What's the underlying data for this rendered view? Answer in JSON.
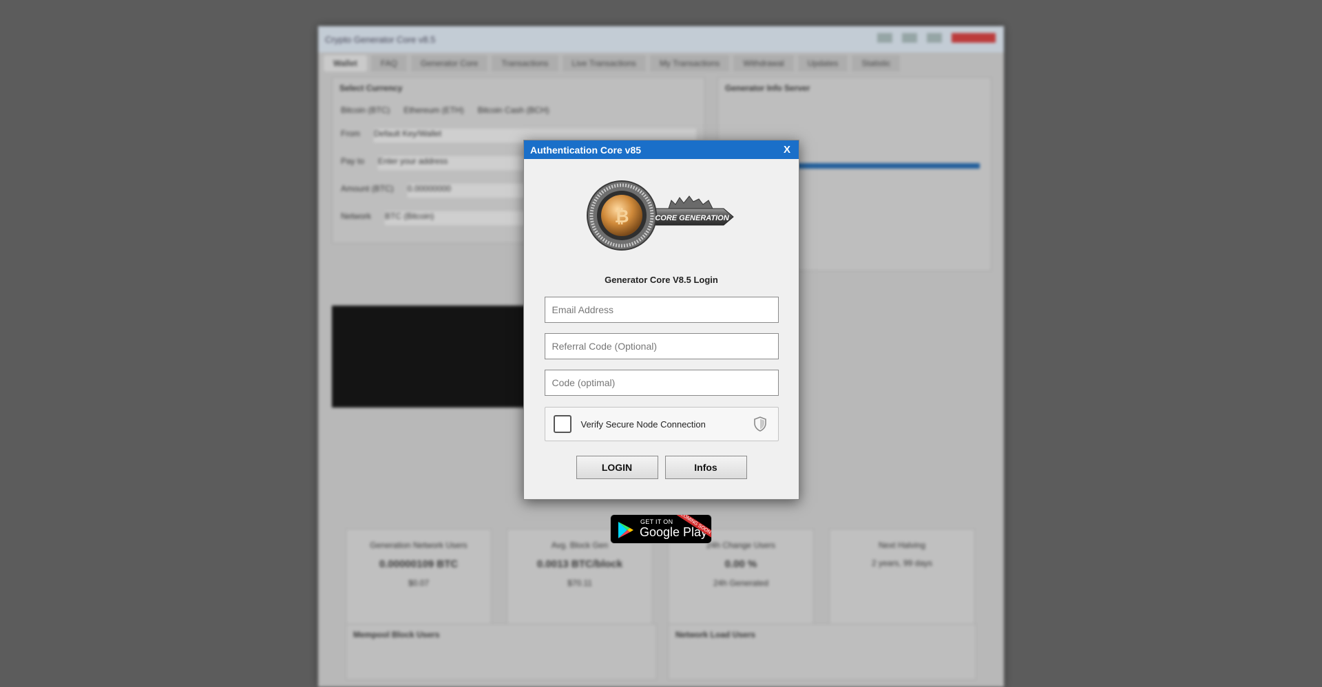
{
  "background_app": {
    "window_title": "Crypto Generator Core v8.5",
    "tabs": [
      "Wallet",
      "FAQ",
      "Generator Core",
      "Transactions",
      "Live Transactions",
      "My Transactions",
      "Withdrawal",
      "Updates",
      "Statistic"
    ],
    "wallet_currency_label": "Select Currency",
    "currencies": [
      "Bitcoin (BTC)",
      "Ethereum (ETH)",
      "Bitcoin Cash (BCH)"
    ],
    "form_labels": [
      "From",
      "Pay to",
      "Amount (BTC)",
      "Network"
    ],
    "from_value": "Default Key/Wallet",
    "pay_to_placeholder": "Enter your address",
    "amount_value": "0.00000000",
    "network_value": "BTC (Bitcoin)",
    "side_panel_title": "Generator Info Server",
    "cards": [
      {
        "title": "Generation Network Users",
        "value": "0.00000109 BTC",
        "sub": "$0.07"
      },
      {
        "title": "Avg. Block Gen",
        "value": "0.0013 BTC/block",
        "sub": "$70.11"
      },
      {
        "title": "24h Change Users",
        "value": "0.00 %",
        "sub": "24h Generated"
      },
      {
        "title": "Next Halving",
        "value": "",
        "sub": "2 years, 99 days"
      }
    ],
    "bottom_panels": [
      "Mempool Block Users",
      "Network Load Users"
    ]
  },
  "dialog": {
    "title": "Authentication Core v85",
    "close_label": "X",
    "logo_text": "CORE GENERATION",
    "heading": "Generator Core V8.5 Login",
    "email_placeholder": "Email Address",
    "referral_placeholder": "Referral Code (Optional)",
    "code_placeholder": "Code (optimal)",
    "verify_label": "Verify Secure Node Connection",
    "login_label": "LOGIN",
    "infos_label": "Infos"
  },
  "play_badge": {
    "top_text": "GET IT ON",
    "main_text": "Google Play",
    "ribbon": "COMING SOON"
  },
  "colors": {
    "titlebar": "#1a6fc9",
    "dialog_bg": "#f0f0f0",
    "overlay": "#5c5c5c"
  }
}
